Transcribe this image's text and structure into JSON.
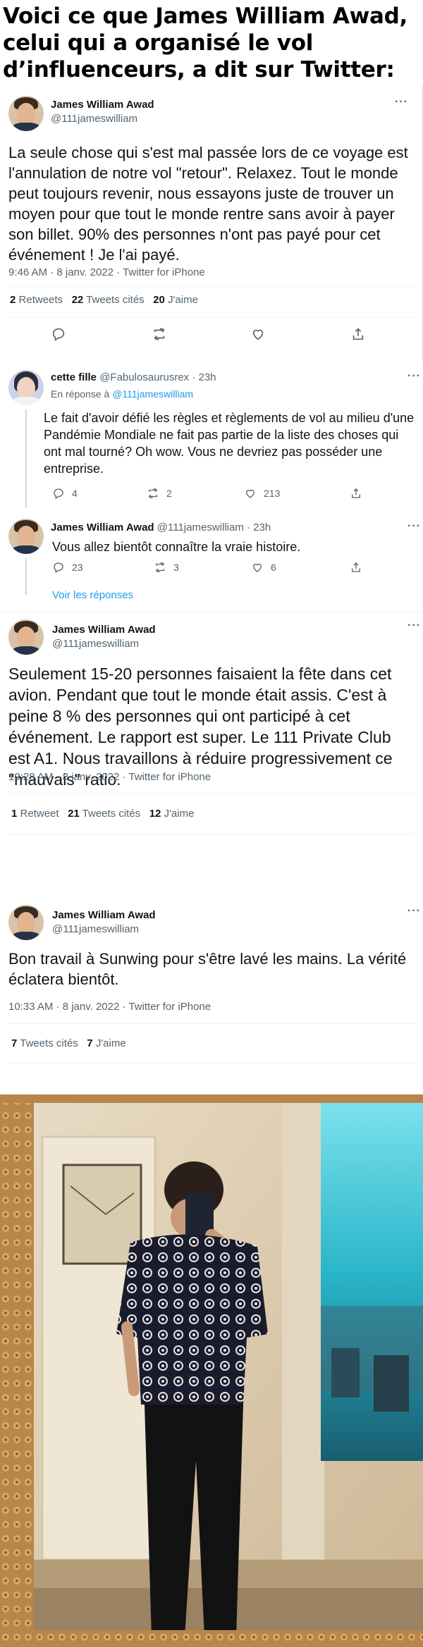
{
  "headline": "Voici ce que James William Awad, celui qui a organisé le vol d’influenceurs, a dit sur Twitter:",
  "tweet1": {
    "name": "James William Awad",
    "handle": "@111jameswilliam",
    "text": "La seule chose qui s'est mal passée lors de ce voyage est l'annulation de notre vol \"retour\". Relaxez. Tout le monde peut toujours revenir, nous essayons juste de trouver un moyen pour que tout le monde rentre sans avoir à payer son billet. 90% des personnes n'ont pas payé pour cet événement ! Je l'ai payé.",
    "meta": "9:46 AM · 8 janv. 2022 · Twitter for iPhone",
    "retweets_count": "2",
    "retweets_label": "Retweets",
    "quotes_count": "22",
    "quotes_label": "Tweets cités",
    "likes_count": "20",
    "likes_label": "J'aime",
    "icons": [
      "reply-icon",
      "retweet-icon",
      "like-icon",
      "share-icon"
    ]
  },
  "reply1": {
    "name": "cette fille",
    "handle": "@Fabulosaurusrex",
    "sep": "·",
    "time": "23h",
    "in_reply_label": "En réponse à",
    "in_reply_handle": "@111jameswilliam",
    "text": "Le fait d'avoir défié les règles et règlements de vol au milieu d'une Pandémie Mondiale ne fait pas partie de la liste des choses qui ont mal tourné? Oh wow. Vous ne devriez pas posséder une entreprise.",
    "replies": "4",
    "retweets": "2",
    "likes": "213"
  },
  "reply2": {
    "name": "James William Awad",
    "handle": "@111jameswilliam",
    "sep": "·",
    "time": "23h",
    "text": "Vous allez bientôt connaître la vraie histoire.",
    "replies": "23",
    "retweets": "3",
    "likes": "6",
    "see_replies": "Voir les réponses"
  },
  "tweet3": {
    "name": "James William Awad",
    "handle": "@111jameswilliam",
    "text": "Seulement 15-20 personnes faisaient la fête dans cet avion. Pendant que tout le monde était assis. C'est à peine 8 % des personnes qui ont participé à cet événement. Le rapport est super. Le 111 Private Club est A1. Nous travaillons à réduire progressivement ce \"mauvais\" ratio.",
    "meta": "10:28 AM · 8 janv. 2022 · Twitter for iPhone",
    "retweets_count": "1",
    "retweets_label": "Retweet",
    "quotes_count": "21",
    "quotes_label": "Tweets cités",
    "likes_count": "12",
    "likes_label": "J'aime"
  },
  "tweet4": {
    "name": "James William Awad",
    "handle": "@111jameswilliam",
    "text": "Bon travail à Sunwing pour s'être lavé les mains. La vérité éclatera bientôt.",
    "meta": "10:33 AM · 8 janv. 2022 · Twitter for iPhone",
    "quotes_count": "7",
    "quotes_label": "Tweets cités",
    "likes_count": "7",
    "likes_label": "J'aime"
  },
  "photo": {
    "subject": "mirror-selfie-photo",
    "colors": {
      "frame": "#b8864a",
      "wall": "#e8dcc6",
      "shirt": "#1a1c2e",
      "pants": "#121212",
      "pool": "#2fb6c9"
    }
  },
  "colors": {
    "text": "#0f1419",
    "muted": "#536471",
    "link": "#1d9bf0",
    "divider": "#eff3f4"
  }
}
